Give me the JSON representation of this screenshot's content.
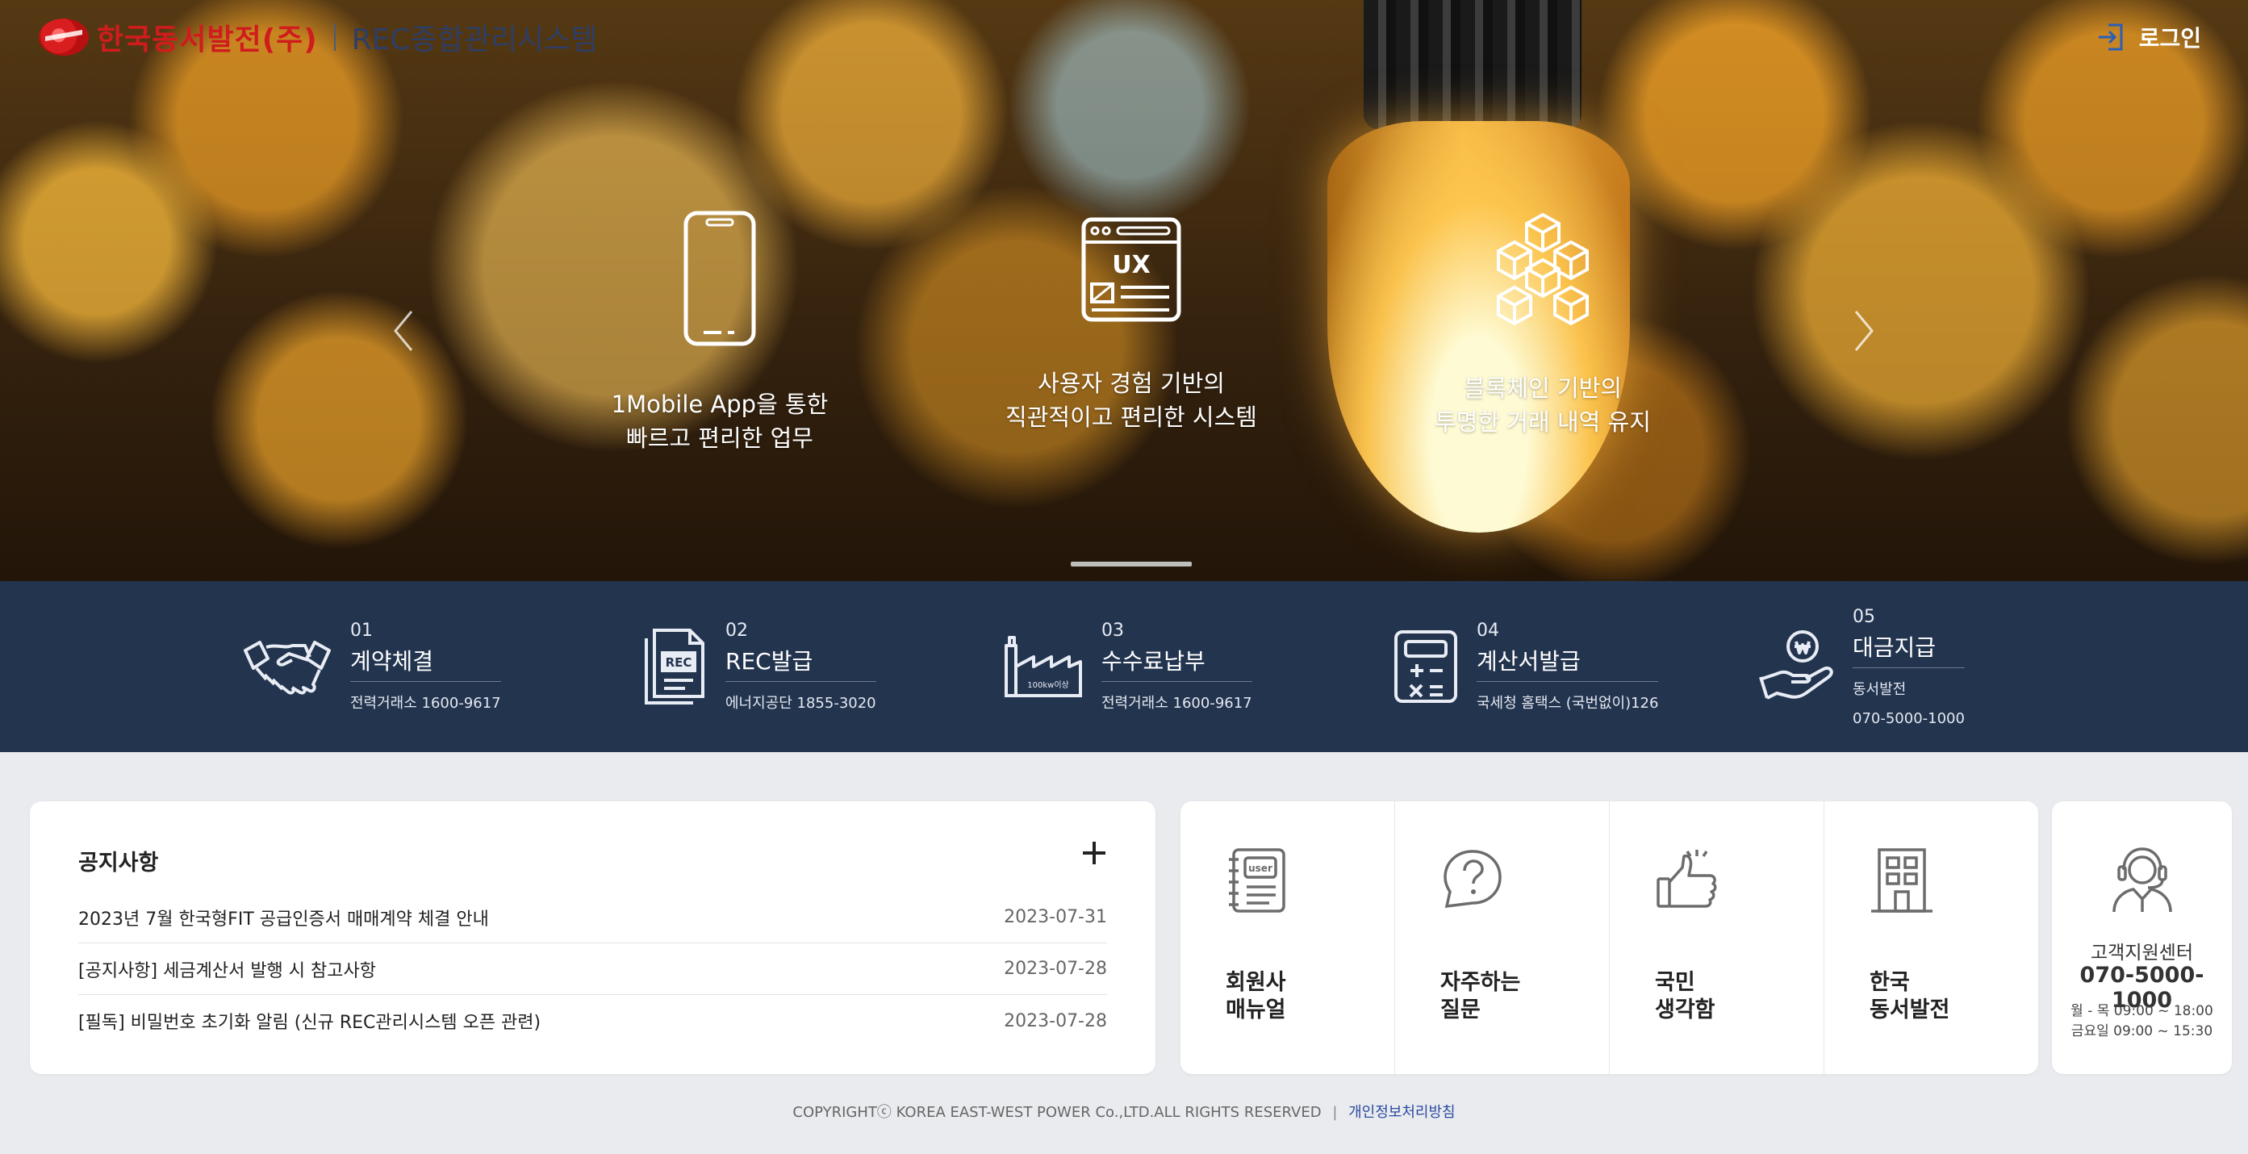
{
  "header": {
    "company_name": "한국동서발전(주)",
    "system_name": "REC종합관리시스템",
    "login_label": "로그인"
  },
  "hero": {
    "features": [
      {
        "icon": "mobile-phone-icon",
        "line1": "1Mobile App을 통한",
        "line2": "빠르고 편리한 업무"
      },
      {
        "icon": "ux-window-icon",
        "icon_text": "UX",
        "line1": "사용자 경험 기반의",
        "line2": "직관적이고 편리한 시스템"
      },
      {
        "icon": "blockchain-cubes-icon",
        "line1": "블록체인 기반의",
        "line2": "투명한 거래 내역 유지"
      }
    ]
  },
  "steps": [
    {
      "icon": "handshake-icon",
      "num": "01",
      "title": "계약체결",
      "sub": "전력거래소 1600-9617"
    },
    {
      "icon": "rec-document-icon",
      "icon_text": "REC",
      "num": "02",
      "title": "REC발급",
      "sub": "에너지공단 1855-3020"
    },
    {
      "icon": "factory-icon",
      "icon_text": "100kw이상",
      "num": "03",
      "title": "수수료납부",
      "sub": "전력거래소 1600-9617"
    },
    {
      "icon": "calculator-icon",
      "num": "04",
      "title": "계산서발급",
      "sub": "국세청 홈택스 (국번없이)126"
    },
    {
      "icon": "won-hand-icon",
      "num": "05",
      "title": "대금지급",
      "sub": "동서발전",
      "sub2": "070-5000-1000"
    }
  ],
  "notice": {
    "title": "공지사항",
    "items": [
      {
        "text": "2023년 7월 한국형FIT 공급인증서 매매계약 체결 안내",
        "date": "2023-07-31"
      },
      {
        "text": "[공지사항] 세금계산서 발행 시 참고사항",
        "date": "2023-07-28"
      },
      {
        "text": "[필독] 비밀번호 초기화 알림 (신규 REC관리시스템 오픈 관련)",
        "date": "2023-07-28"
      }
    ]
  },
  "quick_links": [
    {
      "icon": "manual-notebook-icon",
      "icon_text": "user",
      "line1": "회원사",
      "line2": "매뉴얼"
    },
    {
      "icon": "question-bubble-icon",
      "line1": "자주하는",
      "line2": "질문"
    },
    {
      "icon": "thumbs-up-icon",
      "line1": "국민",
      "line2": "생각함"
    },
    {
      "icon": "building-icon",
      "line1": "한국",
      "line2": "동서발전"
    }
  ],
  "support": {
    "icon": "headset-agent-icon",
    "title": "고객지원센터",
    "phone": "070-5000-1000",
    "hours1": "월 - 목 09:00 ~ 18:00",
    "hours2": "금요일 09:00 ~ 15:30"
  },
  "footer": {
    "copyright": "COPYRIGHTⓒ KOREA EAST-WEST POWER Co.,LTD.ALL RIGHTS RESERVED",
    "separator": "|",
    "privacy_link": "개인정보처리방침"
  },
  "colors": {
    "navy_strip": "#23344f",
    "brand_red": "#d01c1c",
    "brand_navy": "#2e3e66",
    "page_bg": "#e9ebef",
    "privacy_link": "#2c4aa0"
  }
}
